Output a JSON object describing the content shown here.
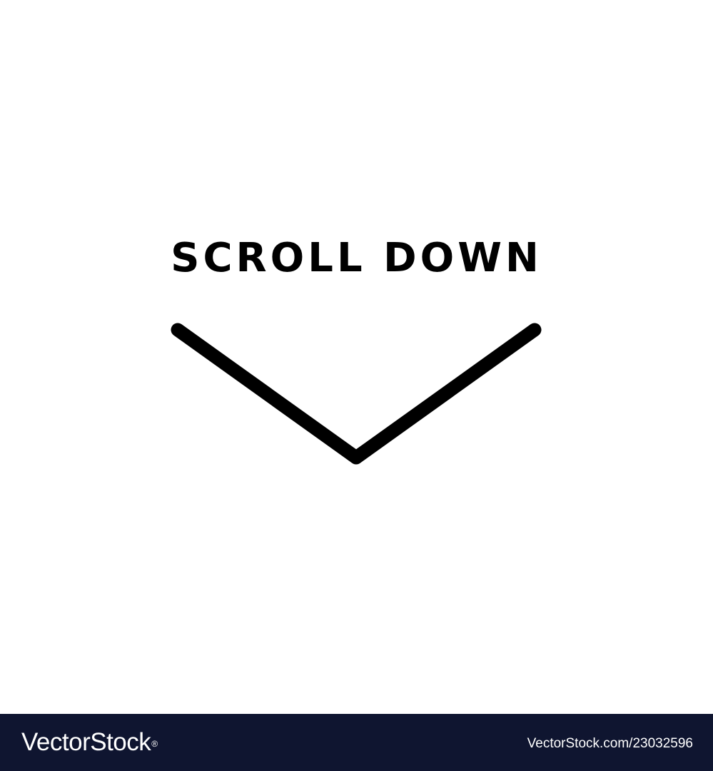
{
  "main": {
    "headline": "SCROLL DOWN",
    "indicator_icon": "chevron-down-icon"
  },
  "footer": {
    "brand": "VectorStock",
    "brand_mark": "®",
    "image_id": "VectorStock.com/23032596"
  },
  "colors": {
    "background": "#ffffff",
    "text": "#000000",
    "footer_bg": "#0f1530",
    "footer_text": "#ffffff"
  }
}
